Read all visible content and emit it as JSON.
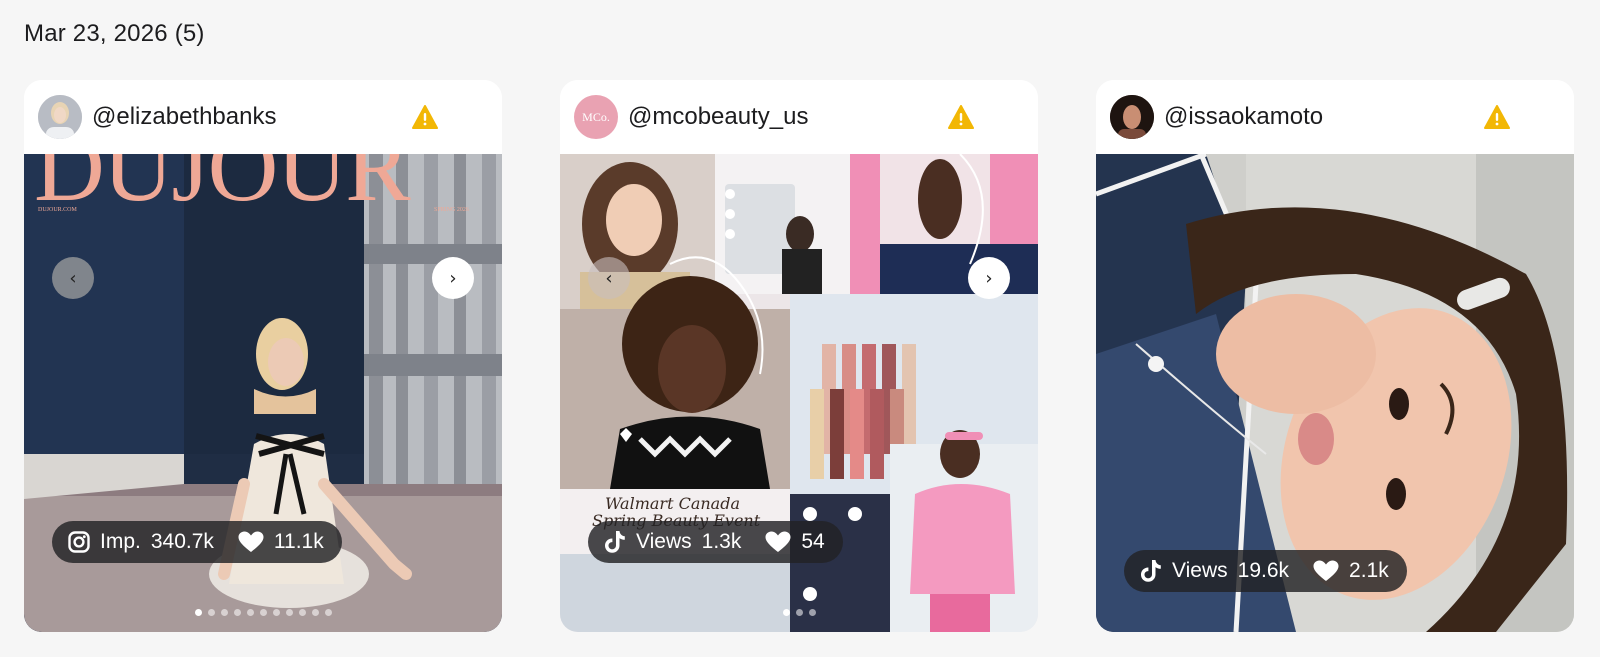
{
  "date_heading": "Mar 23, 2026 (5)",
  "colors": {
    "warning": "#f2b705",
    "stats_bg": "#222224",
    "page_bg": "#f6f6f6"
  },
  "cards": [
    {
      "handle": "@elizabethbanks",
      "platform_icon": "instagram-icon",
      "metric_label": "Imp.",
      "metric_value": "340.7k",
      "likes": "11.1k",
      "magazine_title": "DUJOUR",
      "magazine_site": "DUJOUR.COM",
      "magazine_issue": "SPRING 2026",
      "carousel_dots": 11,
      "active_dot": 0
    },
    {
      "handle": "@mcobeauty_us",
      "avatar_text": "MCo.",
      "platform_icon": "tiktok-icon",
      "metric_label": "Views",
      "metric_value": "1.3k",
      "likes": "54",
      "event_text_line1": "Walmart Canada",
      "event_text_line2": "Spring Beauty Event",
      "carousel_dots": 3,
      "active_dot": 0
    },
    {
      "handle": "@issaokamoto",
      "platform_icon": "tiktok-icon",
      "metric_label": "Views",
      "metric_value": "19.6k",
      "likes": "2.1k"
    }
  ]
}
